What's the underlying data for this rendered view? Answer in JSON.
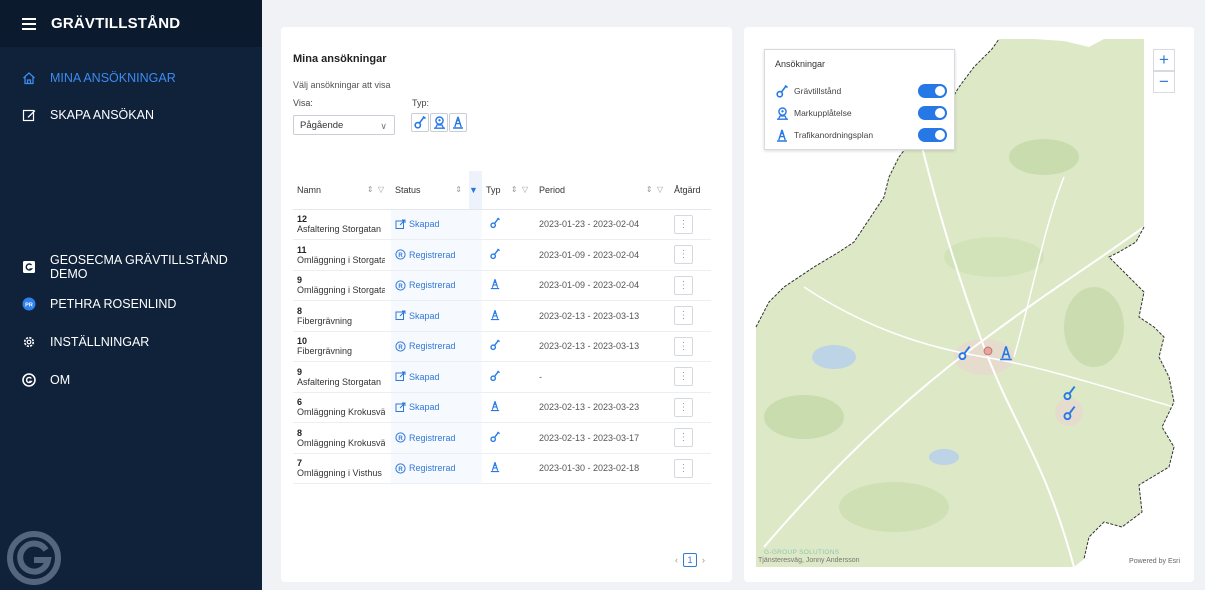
{
  "app": {
    "title": "GRÄVTILLSTÅND"
  },
  "sidebar": {
    "items": [
      {
        "label": "MINA ANSÖKNINGAR",
        "icon": "home-icon",
        "active": true
      },
      {
        "label": "SKAPA ANSÖKAN",
        "icon": "edit-icon",
        "active": false
      },
      {
        "label": "GEOSECMA GRÄVTILLSTÅND DEMO",
        "icon": "org-icon",
        "active": false
      },
      {
        "label": "PETHRA ROSENLIND",
        "icon": "user-avatar-icon",
        "initials": "PR",
        "active": false
      },
      {
        "label": "INSTÄLLNINGAR",
        "icon": "settings-icon",
        "active": false
      },
      {
        "label": "OM",
        "icon": "about-icon",
        "active": false
      }
    ],
    "logo": "geosecma-logo"
  },
  "list": {
    "title": "Mina ansökningar",
    "subtitle": "Välj ansökningar att visa",
    "filter_visa_label": "Visa:",
    "filter_visa_value": "Pågående",
    "filter_typ_label": "Typ:",
    "columns": [
      "Namn",
      "Status",
      "Typ",
      "Period",
      "Åtgärd"
    ],
    "rows": [
      {
        "id": "12",
        "name": "Asfaltering Storgatan",
        "status": "Skapad",
        "type": "digging",
        "period": "2023-01-23 - 2023-02-04"
      },
      {
        "id": "11",
        "name": "Omläggning i Storgata",
        "status": "Registrerad",
        "type": "digging",
        "period": "2023-01-09 - 2023-02-04"
      },
      {
        "id": "9",
        "name": "Omläggning i Storgata",
        "status": "Registrerad",
        "type": "traffic",
        "period": "2023-01-09 - 2023-02-04"
      },
      {
        "id": "8",
        "name": "Fibergrävning",
        "status": "Skapad",
        "type": "traffic",
        "period": "2023-02-13 - 2023-03-13"
      },
      {
        "id": "10",
        "name": "Fibergrävning",
        "status": "Registrerad",
        "type": "digging",
        "period": "2023-02-13 - 2023-03-13"
      },
      {
        "id": "9",
        "name": "Asfaltering Storgatan",
        "status": "Skapad",
        "type": "digging",
        "period": "-"
      },
      {
        "id": "6",
        "name": "Omläggning Krokusvä",
        "status": "Skapad",
        "type": "traffic",
        "period": "2023-02-13 - 2023-03-23"
      },
      {
        "id": "8",
        "name": "Omläggning Krokusvä",
        "status": "Registrerad",
        "type": "digging",
        "period": "2023-02-13 - 2023-03-17"
      },
      {
        "id": "7",
        "name": "Omläggning i Visthus",
        "status": "Registrerad",
        "type": "traffic",
        "period": "2023-01-30 - 2023-02-18"
      }
    ],
    "pagination": {
      "current": "1"
    }
  },
  "map": {
    "legend": {
      "title": "Ansökningar",
      "items": [
        {
          "label": "Grävtillstånd",
          "icon": "shovel-icon",
          "on": true
        },
        {
          "label": "Markupplåtelse",
          "icon": "location-person-icon",
          "on": true
        },
        {
          "label": "Trafikanordningsplan",
          "icon": "traffic-cone-icon",
          "on": true
        }
      ]
    },
    "zoom_in": "+",
    "zoom_out": "−",
    "brand": "G-GROUP SOLUTIONS",
    "credit": "Tjänsteresväg, Jonny Andersson",
    "attribution": "Powered by Esri"
  },
  "colors": {
    "sidebar": "#10213a",
    "accent": "#2678e6",
    "map_land": "#dfe9c7",
    "map_outside": "#ffffff"
  }
}
